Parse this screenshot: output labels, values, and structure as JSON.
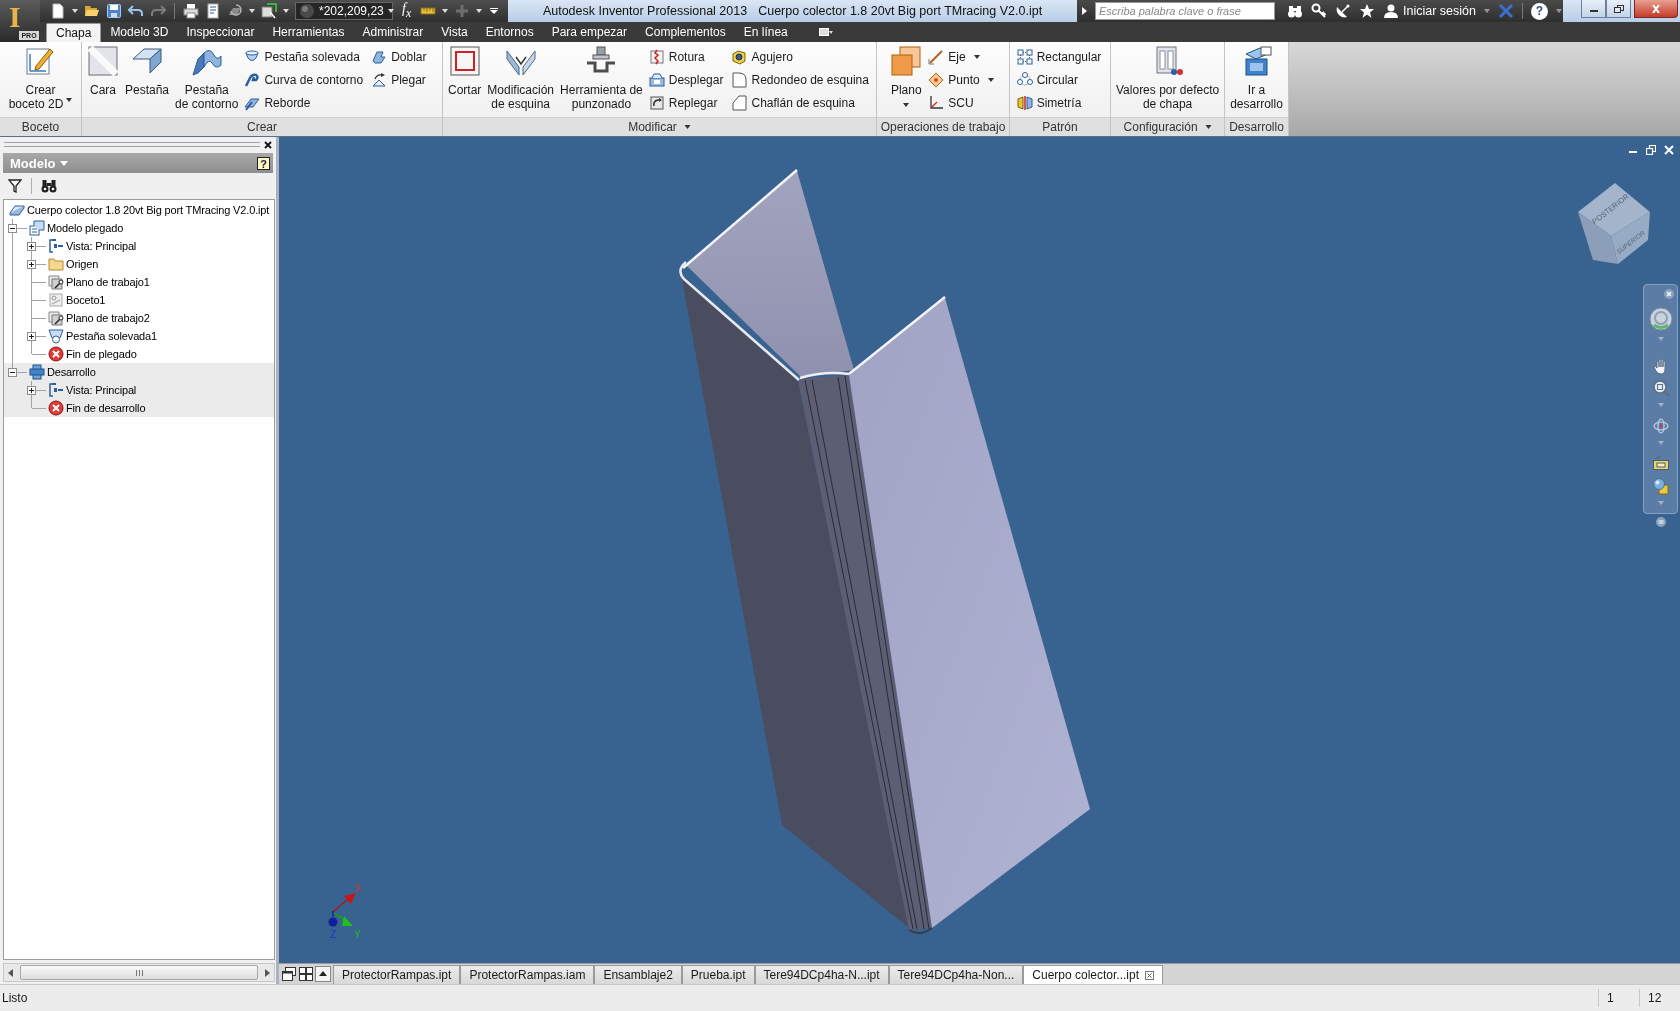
{
  "app_button": {
    "letter": "I",
    "badge": "PRO"
  },
  "quick_access": {
    "appearance": "*202,209,23",
    "parameters": "f$_{x}$"
  },
  "title": {
    "application": "Autodesk Inventor Professional 2013",
    "document": "Cuerpo colector 1.8 20vt Big port TMracing V2.0.ipt"
  },
  "info_center": {
    "search_placeholder": "Escriba palabra clave o frase",
    "sign_in": "Iniciar sesión",
    "help": "?"
  },
  "ribbon_tabs": [
    {
      "label": "Chapa",
      "selected": true
    },
    {
      "label": "Modelo 3D",
      "selected": false
    },
    {
      "label": "Inspeccionar",
      "selected": false
    },
    {
      "label": "Herramientas",
      "selected": false
    },
    {
      "label": "Administrar",
      "selected": false
    },
    {
      "label": "Vista",
      "selected": false
    },
    {
      "label": "Entornos",
      "selected": false
    },
    {
      "label": "Para empezar",
      "selected": false
    },
    {
      "label": "Complementos",
      "selected": false
    },
    {
      "label": "En línea",
      "selected": false
    }
  ],
  "ribbon_panels": [
    {
      "label": "Boceto",
      "menu": false,
      "groups": [
        {
          "kind": "large",
          "label": "Crear\nboceto 2D",
          "menu": true
        }
      ]
    },
    {
      "label": "Crear",
      "menu": false,
      "groups": [
        {
          "kind": "large",
          "label": "Cara",
          "menu": false
        },
        {
          "kind": "large",
          "label": "Pestaña",
          "menu": false
        },
        {
          "kind": "large",
          "label": "Pestaña\nde contorno",
          "menu": false
        },
        {
          "kind": "column",
          "items": [
            {
              "label": "Pestaña solevada",
              "menu": false
            },
            {
              "label": "Curva de contorno",
              "menu": false
            },
            {
              "label": "Reborde",
              "menu": false
            }
          ]
        },
        {
          "kind": "column",
          "items": [
            {
              "label": "Doblar",
              "menu": false
            },
            {
              "label": "Plegar",
              "menu": false
            }
          ]
        }
      ]
    },
    {
      "label": "Modificar",
      "menu": true,
      "groups": [
        {
          "kind": "large",
          "label": "Cortar",
          "menu": false
        },
        {
          "kind": "large",
          "label": "Modificación\nde esquina",
          "menu": false
        },
        {
          "kind": "large",
          "label": "Herramienta de\npunzonado",
          "menu": false
        },
        {
          "kind": "column",
          "items": [
            {
              "label": "Rotura",
              "menu": false
            },
            {
              "label": "Desplegar",
              "menu": false
            },
            {
              "label": "Replegar",
              "menu": false
            }
          ]
        },
        {
          "kind": "column",
          "items": [
            {
              "label": "Agujero",
              "menu": false
            },
            {
              "label": "Redondeo de esquina",
              "menu": false
            },
            {
              "label": "Chaflán de esquina",
              "menu": false
            }
          ]
        }
      ]
    },
    {
      "label": "Operaciones de trabajo",
      "menu": false,
      "groups": [
        {
          "kind": "large",
          "label": "Plano",
          "menu": true
        },
        {
          "kind": "column",
          "items": [
            {
              "label": "Eje",
              "menu": true
            },
            {
              "label": "Punto",
              "menu": true
            },
            {
              "label": "SCU",
              "menu": false
            }
          ]
        }
      ]
    },
    {
      "label": "Patrón",
      "menu": false,
      "groups": [
        {
          "kind": "column",
          "items": [
            {
              "label": "Rectangular",
              "menu": false
            },
            {
              "label": "Circular",
              "menu": false
            },
            {
              "label": "Simetría",
              "menu": false
            }
          ]
        }
      ]
    },
    {
      "label": "Configuración",
      "menu": true,
      "groups": [
        {
          "kind": "large",
          "label": "Valores por defecto\nde chapa",
          "menu": false
        }
      ]
    },
    {
      "label": "Desarrollo",
      "menu": false,
      "groups": [
        {
          "kind": "large",
          "label": "Ir a\ndesarrollo",
          "menu": false
        }
      ]
    }
  ],
  "browser": {
    "title": "Modelo",
    "help": "?",
    "tree": {
      "label": "Cuerpo colector 1.8 20vt Big port TMracing V2.0.ipt",
      "kind": "part",
      "children": [
        {
          "label": "Modelo plegado",
          "kind": "folded",
          "expanded": true,
          "active": true,
          "children": [
            {
              "label": "Vista: Principal",
              "kind": "view",
              "expanded": false
            },
            {
              "label": "Origen",
              "kind": "folder",
              "expanded": false
            },
            {
              "label": "Plano de trabajo1",
              "kind": "plane"
            },
            {
              "label": "Boceto1",
              "kind": "sketch"
            },
            {
              "label": "Plano de trabajo2",
              "kind": "plane"
            },
            {
              "label": "Pestaña solevada1",
              "kind": "flange",
              "expanded": false
            },
            {
              "label": "Fin de plegado",
              "kind": "end"
            }
          ]
        },
        {
          "label": "Desarrollo",
          "kind": "flat",
          "expanded": true,
          "active": false,
          "children": [
            {
              "label": "Vista: Principal",
              "kind": "view",
              "expanded": false
            },
            {
              "label": "Fin de desarrollo",
              "kind": "end"
            }
          ]
        }
      ]
    }
  },
  "viewport": {
    "view_cube": {
      "faces": [
        "POSTERIOR",
        "SUPERIOR"
      ]
    },
    "axes": {
      "x": "X",
      "y": "Y",
      "z": "Z"
    }
  },
  "document_tabs": [
    {
      "label": "ProtectorRampas.ipt",
      "selected": false
    },
    {
      "label": "ProtectorRampas.iam",
      "selected": false
    },
    {
      "label": "Ensamblaje2",
      "selected": false
    },
    {
      "label": "Prueba.ipt",
      "selected": false
    },
    {
      "label": "Tere94DCp4ha-N...ipt",
      "selected": false
    },
    {
      "label": "Tere94DCp4ha-Non...",
      "selected": false
    },
    {
      "label": "Cuerpo colector...ipt",
      "selected": true
    }
  ],
  "status_bar": {
    "message": "Listo",
    "cells": [
      "1",
      "12"
    ]
  }
}
